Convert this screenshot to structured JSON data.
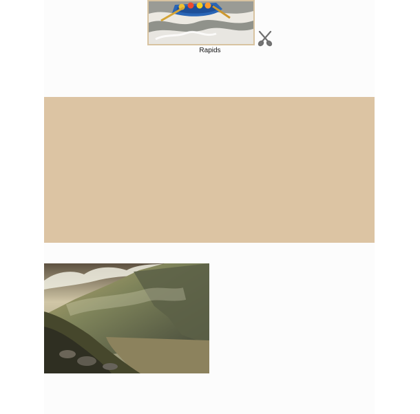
{
  "rapids": {
    "caption": "Rapids",
    "photo_icon": "rafting-photo",
    "side_icon": "crossed-paddles-icon"
  },
  "band": {
    "color": "#dcc4a3"
  },
  "landscape": {
    "photo_icon": "mountain-valley-photo"
  }
}
